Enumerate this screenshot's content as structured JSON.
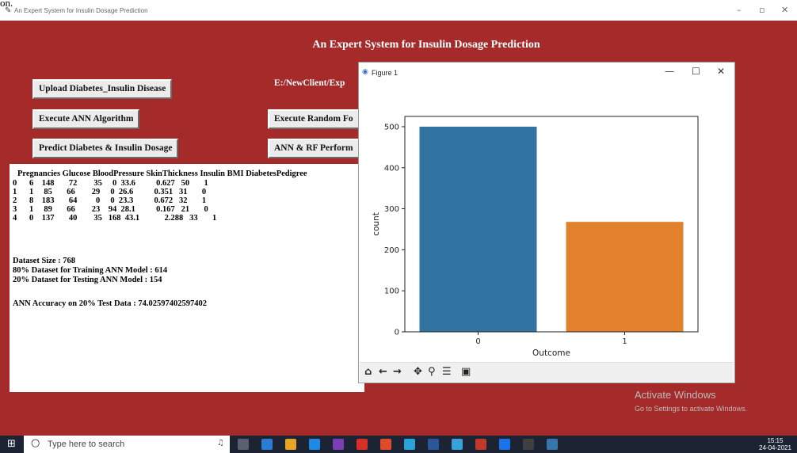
{
  "window": {
    "title": "An Expert System for Insulin Dosage Prediction",
    "min": "–",
    "max": "▫",
    "close": "✕"
  },
  "top_fragment": "on.",
  "app": {
    "title": "An Expert System for Insulin Dosage Prediction",
    "buttons": {
      "upload": "Upload Diabetes_Insulin Disease",
      "ann": "Execute ANN Algorithm",
      "predict": "Predict Diabetes & Insulin Dosage",
      "rf": "Execute Random Fo",
      "perf": "ANN & RF Perform"
    },
    "path_label": "E:/NewClient/Exp"
  },
  "output": {
    "header": "Pregnancies  Glucose  BloodPressure  SkinThickness  Insulin  BMI  DiabetesPedigree",
    "rows": [
      "0      6    148       72        35     0  33.6          0.627   50       1",
      "1      1     85       66        29     0  26.6          0.351   31       0",
      "2      8    183       64         0     0  23.3          0.672   32       1",
      "3      1     89       66        23    94  28.1          0.167   21       0",
      "4      0    137       40        35   168  43.1            2.288   33       1"
    ],
    "info": [
      "Dataset Size  : 768",
      "80% Dataset for Training ANN Model : 614",
      "20% Dataset for Testing ANN Model  : 154",
      "ANN Accuracy on 20% Test Data : 74.02597402597402"
    ]
  },
  "figure": {
    "title": "Figure 1",
    "min": "—",
    "max": "☐",
    "close": "✕",
    "toolbar_icons": [
      "home-icon",
      "back-icon",
      "forward-icon",
      "pan-icon",
      "zoom-icon",
      "configure-icon",
      "save-icon"
    ]
  },
  "chart_data": {
    "type": "bar",
    "categories": [
      "0",
      "1"
    ],
    "values": [
      500,
      268
    ],
    "colors": [
      "#3274a1",
      "#e1812c"
    ],
    "xlabel": "Outcome",
    "ylabel": "count",
    "ylim": [
      0,
      525
    ],
    "yticks": [
      0,
      100,
      200,
      300,
      400,
      500
    ],
    "grid": false
  },
  "watermark": {
    "line1": "Activate Windows",
    "line2": "Go to Settings to activate Windows."
  },
  "taskbar": {
    "search_placeholder": "Type here to search",
    "time": "15:15",
    "date": "24-04-2021"
  }
}
